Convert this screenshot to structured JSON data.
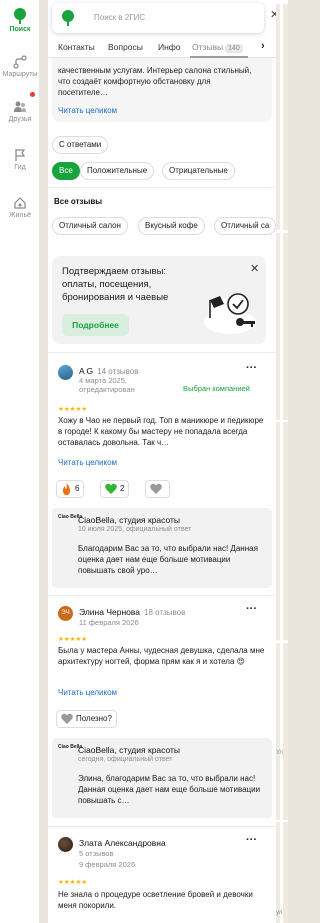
{
  "rail": {
    "items": [
      {
        "label": "Поиск",
        "icon": "search-leaf-icon"
      },
      {
        "label": "Маршруты",
        "icon": "route-icon"
      },
      {
        "label": "Друзья",
        "icon": "friends-icon"
      },
      {
        "label": "Гид",
        "icon": "guide-flag-icon"
      },
      {
        "label": "Жильё",
        "icon": "housing-icon"
      }
    ],
    "active_color": "#19a33d",
    "notification_color": "#e53935"
  },
  "search": {
    "placeholder": "Поиск в 2ГИС"
  },
  "tabs": {
    "items": [
      "Контакты",
      "Вопросы",
      "Инфо",
      "Отзывы"
    ],
    "reviews_count": "140"
  },
  "description": {
    "text": "качественным услугам. Интерьер салона стильный, что создаёт комфортную обстановку для посетителе…",
    "read_more": "Читать целиком"
  },
  "filters": {
    "with_answers": "С ответами",
    "sentiment": [
      "Все",
      "Положительные",
      "Отрицательные"
    ],
    "all_reviews_title": "Все отзывы",
    "tags": [
      "Отличный салон",
      "Вкусный кофе",
      "Отличный са"
    ]
  },
  "promo": {
    "text": "Подтверждаем отзывы: оплаты, посещения, бронирования и чаевые",
    "button": "Подробнее"
  },
  "reviews": [
    {
      "name": "A G",
      "count": "14 отзывов",
      "date_line1": "4 марта 2025,",
      "date_line2": "отредактирован",
      "chosen": "Выбран компанией",
      "stars": "★★★★★",
      "text": "Хожу в Чао не первый год. Топ в маникюре и педикюре в городе! К какому бы мастеру не попадала всегда оставалась довольна. Так ч…",
      "read_more": "Читать целиком",
      "reactions": [
        "6",
        "2"
      ]
    },
    {
      "name": "Элина Чернова",
      "count": "18 отзывов",
      "date": "11 февраля 2026",
      "stars": "★★★★★",
      "text": "Была у мастера Анны, чудесная девушка, сделала мне архитектуру ногтей, форма прям как я и хотела 😍",
      "read_more": "Читать целиком",
      "helpful": "Полезно?"
    },
    {
      "name": "Злата Александровна",
      "count": "5 отзывов",
      "date": "9 февраля 2026",
      "stars": "★★★★★",
      "text": "Не знала о процедуре осветление бровей и девочки меня покорили."
    }
  ],
  "replies": [
    {
      "logo": "Ciao Bella",
      "name": "CiaoBella, студия красоты",
      "sub": "10 июля 2025, официальный ответ",
      "text": "Благодарим Вас за то, что выбрали нас! Данная оценка дает нам еще больше мотивации повышать свой уро…"
    },
    {
      "logo": "Ciao Bella",
      "name": "CiaoBella, студия красоты",
      "sub": "сегодня, официальный ответ",
      "text": "Элина, благодарим Вас за то, что выбрали нас! Данная оценка дает нам еще больше мотивации повышать с…"
    }
  ],
  "map": {
    "labels": [
      "Ул",
      "ул"
    ]
  }
}
